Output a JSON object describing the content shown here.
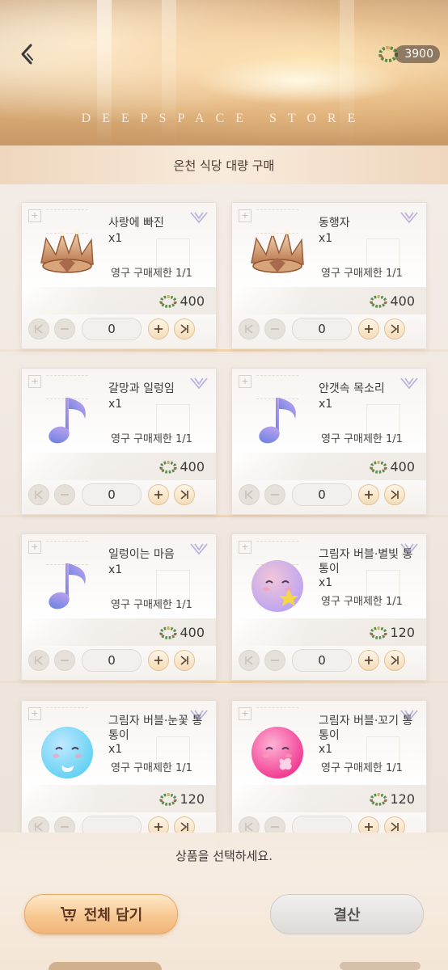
{
  "header": {
    "store_label": "DEEPSPACE STORE",
    "currency_amount": "3900",
    "currency_icon": "wreath-icon"
  },
  "title": "온천 식당 대량 구매",
  "colors": {
    "accent_orange": "#f7c892",
    "wreath_green": "#5a8a4a",
    "title_bar": "#f8ebdc"
  },
  "items": [
    {
      "name": "사랑에 빠진",
      "qty": "x1",
      "limit": "영구 구매제한 1/1",
      "price": "400",
      "count": "0",
      "thumb": "crown"
    },
    {
      "name": "동행자",
      "qty": "x1",
      "limit": "영구 구매제한 1/1",
      "price": "400",
      "count": "0",
      "thumb": "crown"
    },
    {
      "name": "갈망과 일렁임",
      "qty": "x1",
      "limit": "영구 구매제한 1/1",
      "price": "400",
      "count": "0",
      "thumb": "note"
    },
    {
      "name": "안갯속 목소리",
      "qty": "x1",
      "limit": "영구 구매제한 1/1",
      "price": "400",
      "count": "0",
      "thumb": "note"
    },
    {
      "name": "일렁이는 마음",
      "qty": "x1",
      "limit": "영구 구매제한 1/1",
      "price": "400",
      "count": "0",
      "thumb": "note"
    },
    {
      "name": "그림자 버블·별빛 통통이",
      "qty": "x1",
      "limit": "영구 구매제한 1/1",
      "price": "120",
      "count": "0",
      "thumb": "bubble-purple"
    },
    {
      "name": "그림자 버블·눈꽃 통통이",
      "qty": "x1",
      "limit": "영구 구매제한 1/1",
      "price": "120",
      "count": "",
      "thumb": "bubble-blue"
    },
    {
      "name": "그림자 버블·꼬기 통통이",
      "qty": "x1",
      "limit": "영구 구매제한 1/1",
      "price": "120",
      "count": "",
      "thumb": "bubble-pink"
    }
  ],
  "bottom": {
    "prompt": "상품을 선택하세요.",
    "add_all": "전체 담기",
    "checkout": "결산"
  }
}
